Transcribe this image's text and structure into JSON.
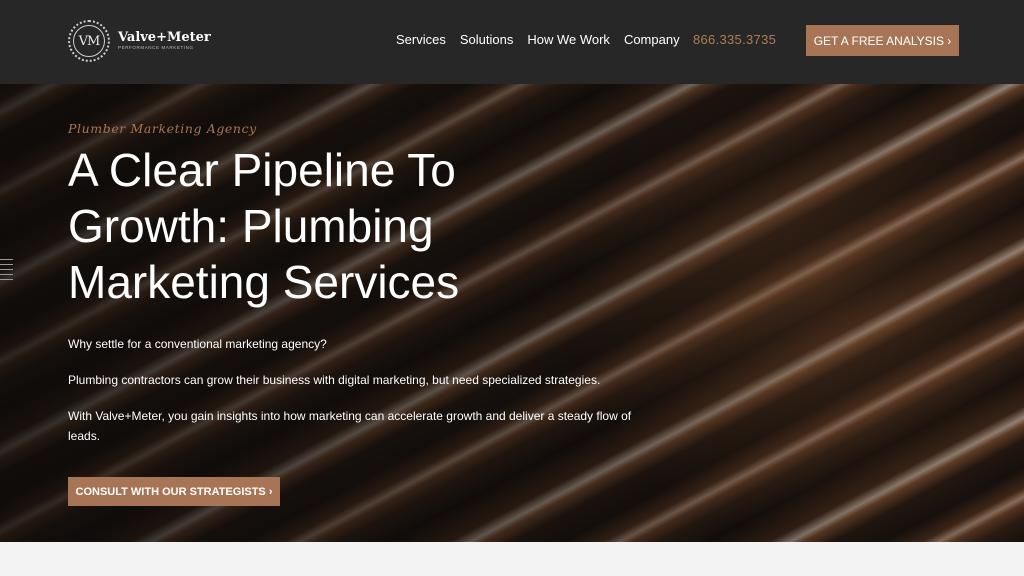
{
  "header": {
    "logo": {
      "monogram": "VM",
      "name": "Valve+Meter",
      "tagline": "PERFORMANCE MARKETING"
    },
    "nav": [
      {
        "label": "Services"
      },
      {
        "label": "Solutions"
      },
      {
        "label": "How We Work"
      },
      {
        "label": "Company"
      }
    ],
    "phone": "866.335.3735",
    "cta_label": "GET A FREE ANALYSIS ›"
  },
  "hero": {
    "eyebrow": "Plumber Marketing Agency",
    "title": "A Clear Pipeline To Growth: Plumbing Marketing Services",
    "paragraphs": [
      "Why settle for a conventional marketing agency?",
      "Plumbing contractors can grow their business with digital marketing, but need specialized strategies.",
      "With Valve+Meter, you gain insights into how marketing can accelerate growth and deliver a steady flow of leads."
    ],
    "cta_label": "CONSULT WITH OUR STRATEGISTS ›"
  },
  "colors": {
    "header_bg": "#272727",
    "accent": "#a87456",
    "phone": "#b47a55",
    "text": "#ffffff"
  },
  "icons": [
    "logo-monogram-icon",
    "side-menu-lines-icon"
  ]
}
